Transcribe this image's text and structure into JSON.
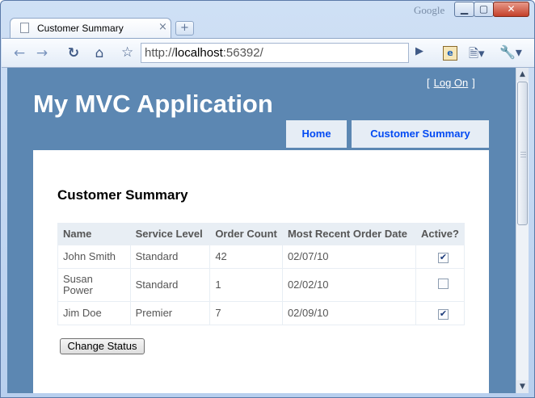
{
  "browser": {
    "brand": "Google",
    "tab_title": "Customer Summary",
    "tab_close": "×",
    "new_tab": "+",
    "url_prefix": "http://",
    "url_host": "localhost",
    "url_rest": ":56392/",
    "buttons": {
      "minimize": "▁",
      "maximize": "▢",
      "close": "✕"
    }
  },
  "page": {
    "logon_open": "[",
    "logon_label": "Log On",
    "logon_close": "]",
    "app_title": "My MVC Application",
    "menu": {
      "home": "Home",
      "customer_summary": "Customer Summary"
    },
    "heading": "Customer Summary",
    "table": {
      "headers": [
        "Name",
        "Service Level",
        "Order Count",
        "Most Recent Order Date",
        "Active?"
      ],
      "rows": [
        {
          "name": "John Smith",
          "service_level": "Standard",
          "order_count": "42",
          "date": "02/07/10",
          "active": true
        },
        {
          "name": "Susan Power",
          "service_level": "Standard",
          "order_count": "1",
          "date": "02/02/10",
          "active": false
        },
        {
          "name": "Jim Doe",
          "service_level": "Premier",
          "order_count": "7",
          "date": "02/09/10",
          "active": true
        }
      ]
    },
    "change_status_label": "Change Status"
  },
  "colors": {
    "header_blue": "#5c87b2",
    "menu_bg": "#e6edf5",
    "link_blue": "#034af3"
  }
}
